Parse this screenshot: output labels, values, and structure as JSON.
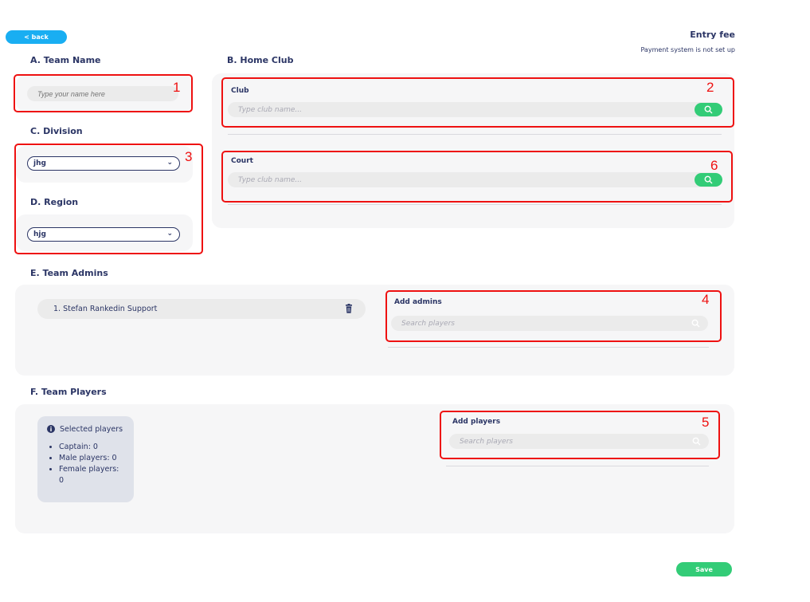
{
  "header": {
    "back_label": "< back",
    "entry_fee_title": "Entry fee",
    "payment_note": "Payment system is not set up"
  },
  "team_name": {
    "title": "A. Team Name",
    "placeholder": "Type your name here"
  },
  "home_club": {
    "title": "B. Home Club",
    "club_label": "Club",
    "club_placeholder": "Type club name...",
    "court_label": "Court",
    "court_placeholder": "Type club name..."
  },
  "division": {
    "title": "C. Division",
    "selected": "jhg"
  },
  "region": {
    "title": "D. Region",
    "selected": "hjg"
  },
  "team_admins": {
    "title": "E. Team Admins",
    "admins": [
      "1. Stefan Rankedin Support"
    ],
    "add_label": "Add admins",
    "search_placeholder": "Search players"
  },
  "team_players": {
    "title": "F. Team Players",
    "selected_title": "Selected players",
    "stats": [
      "Captain: 0",
      "Male players: 0",
      "Female players: 0"
    ],
    "add_label": "Add players",
    "search_placeholder": "Search players"
  },
  "annotations": [
    "1",
    "2",
    "3",
    "4",
    "5",
    "6"
  ],
  "actions": {
    "save_label": "Save"
  },
  "colors": {
    "accent_blue": "#19aef2",
    "accent_green": "#33cc77",
    "text_navy": "#2b3565",
    "annotation_red": "#ee1111"
  }
}
